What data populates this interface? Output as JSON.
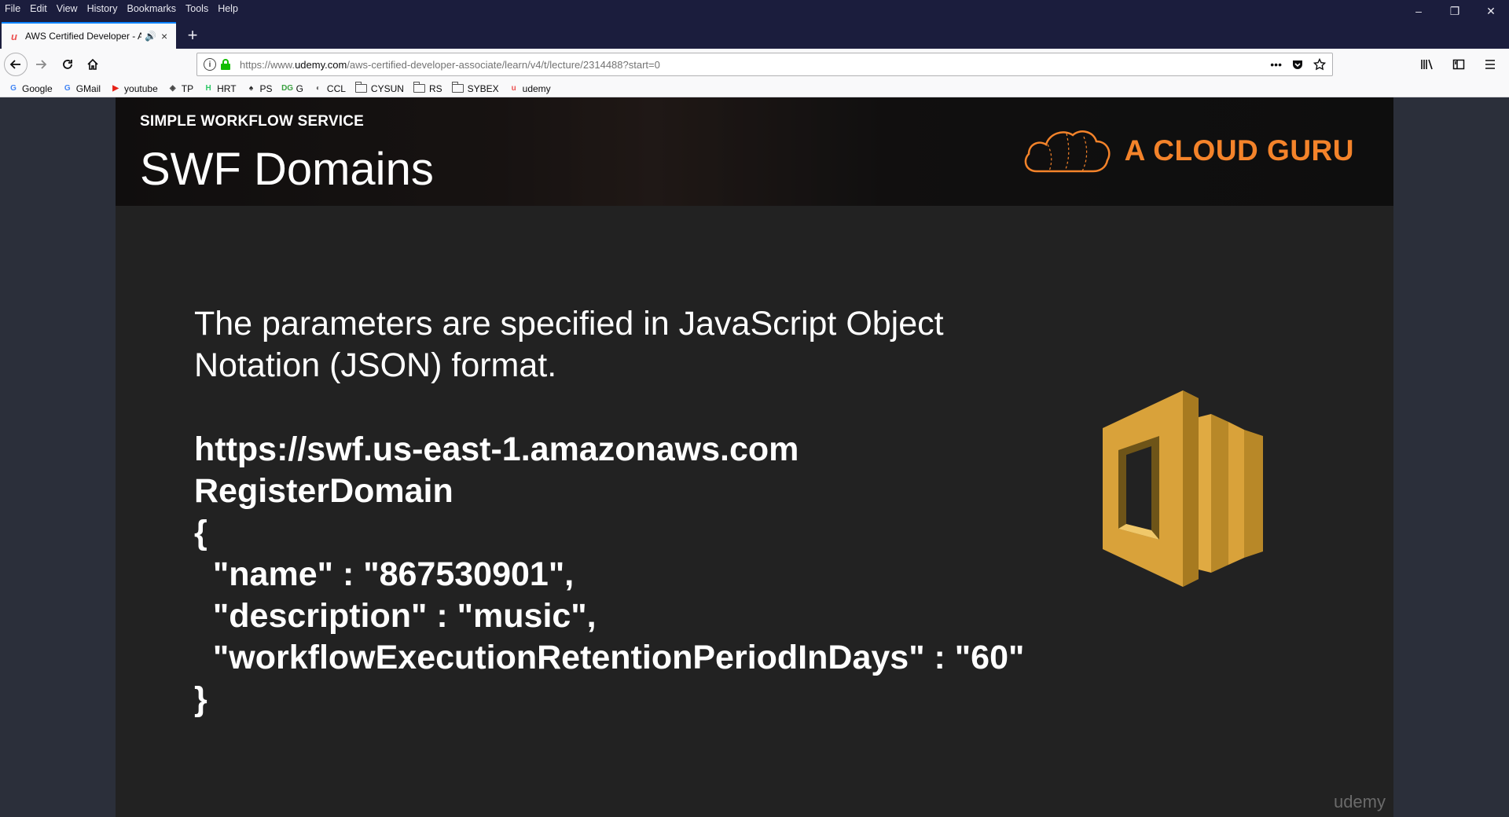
{
  "menubar": {
    "items": [
      "File",
      "Edit",
      "View",
      "History",
      "Bookmarks",
      "Tools",
      "Help"
    ]
  },
  "window_controls": {
    "minimize": "–",
    "restore": "❐",
    "close": "✕"
  },
  "tab": {
    "favicon": "udemy-icon",
    "title": "AWS Certified Developer - A",
    "audio_icon": "🔊",
    "close": "×"
  },
  "new_tab": "+",
  "navbar": {
    "url_scheme": "https://www.",
    "url_host": "udemy.com",
    "url_path": "/aws-certified-developer-associate/learn/v4/t/lecture/2314488?start=0",
    "page_actions": "•••"
  },
  "bookmarks": [
    {
      "label": "Google",
      "icon": "google-icon",
      "glyph": "G",
      "color": "#4285f4"
    },
    {
      "label": "GMail",
      "icon": "gmail-icon",
      "glyph": "G",
      "color": "#4285f4"
    },
    {
      "label": "youtube",
      "icon": "youtube-icon",
      "glyph": "▶",
      "color": "#e62117"
    },
    {
      "label": "TP",
      "icon": "tp-icon",
      "glyph": "◈",
      "color": "#444444"
    },
    {
      "label": "HRT",
      "icon": "hackerrank-icon",
      "glyph": "H",
      "color": "#2ec866"
    },
    {
      "label": "PS",
      "icon": "ps-icon",
      "glyph": "♠",
      "color": "#222222"
    },
    {
      "label": "G",
      "icon": "dg-icon",
      "glyph": "DG",
      "color": "#3aa040"
    },
    {
      "label": "CCL",
      "icon": "ccl-icon",
      "glyph": "◐",
      "color": "#666666"
    },
    {
      "label": "CYSUN",
      "icon": "folder-icon",
      "folder": true
    },
    {
      "label": "RS",
      "icon": "folder-icon",
      "folder": true
    },
    {
      "label": "SYBEX",
      "icon": "folder-icon",
      "folder": true
    },
    {
      "label": "udemy",
      "icon": "udemy-icon",
      "glyph": "u",
      "color": "#ec5252"
    }
  ],
  "slide": {
    "section": "SIMPLE WORKFLOW SERVICE",
    "title": "SWF Domains",
    "brand": "A CLOUD GURU",
    "body_lines": [
      "The parameters are specified in JavaScript Object",
      "Notation (JSON) format."
    ],
    "code_lines": [
      "https://swf.us-east-1.amazonaws.com",
      "RegisterDomain",
      "{",
      "  \"name\" : \"867530901\",",
      "  \"description\" : \"music\",",
      "  \"workflowExecutionRetentionPeriodInDays\" : \"60\"",
      "}"
    ],
    "watermark": "udemy"
  },
  "colors": {
    "brand_orange": "#f4832a",
    "swf_gold": "#d9a23a",
    "tab_accent": "#0a84ff"
  }
}
